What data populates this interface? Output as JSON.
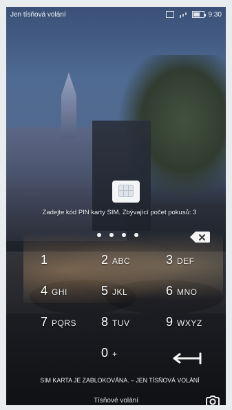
{
  "status_bar": {
    "carrier_text": "Jen tísňová volání",
    "time": "9:30",
    "icons": [
      "sim-card-icon",
      "signal-icon",
      "battery-icon"
    ],
    "battery_level": 0.7
  },
  "sim_lock": {
    "prompt": "Zadejte kód PIN karty SIM. Zbývající počet pokusů: 3",
    "entered_digits_count": 4
  },
  "keypad": {
    "keys": [
      {
        "num": "1",
        "letters": ""
      },
      {
        "num": "2",
        "letters": "ABC"
      },
      {
        "num": "3",
        "letters": "DEF"
      },
      {
        "num": "4",
        "letters": "GHI"
      },
      {
        "num": "5",
        "letters": "JKL"
      },
      {
        "num": "6",
        "letters": "MNO"
      },
      {
        "num": "7",
        "letters": "PQRS"
      },
      {
        "num": "8",
        "letters": "TUV"
      },
      {
        "num": "9",
        "letters": "WXYZ"
      },
      {
        "num": "0",
        "letters": "+"
      }
    ],
    "delete_icon": "backspace-icon",
    "enter_icon": "enter-arrow-icon"
  },
  "footer": {
    "locked_message": "SIM KARTA JE ZABLOKOVÁNA. – JEN TÍSŇOVÁ VOLÁNÍ",
    "emergency_button": "Tísňové volání",
    "camera_icon": "camera-icon"
  }
}
